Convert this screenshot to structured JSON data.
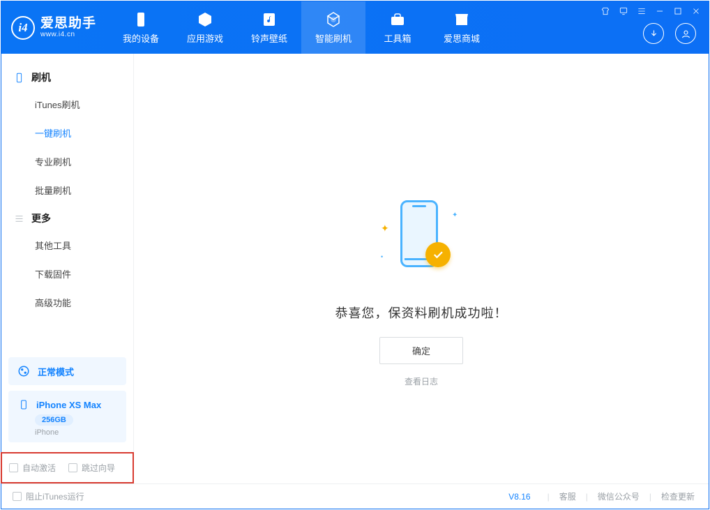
{
  "app": {
    "title": "爱思助手",
    "subtitle": "www.i4.cn"
  },
  "nav": {
    "items": [
      {
        "label": "我的设备",
        "icon": "device"
      },
      {
        "label": "应用游戏",
        "icon": "cube"
      },
      {
        "label": "铃声壁纸",
        "icon": "music"
      },
      {
        "label": "智能刷机",
        "icon": "refresh",
        "active": true
      },
      {
        "label": "工具箱",
        "icon": "toolbox"
      },
      {
        "label": "爱思商城",
        "icon": "store"
      }
    ]
  },
  "sidebar": {
    "section1_title": "刷机",
    "section1_items": [
      {
        "label": "iTunes刷机"
      },
      {
        "label": "一键刷机",
        "active": true
      },
      {
        "label": "专业刷机"
      },
      {
        "label": "批量刷机"
      }
    ],
    "section2_title": "更多",
    "section2_items": [
      {
        "label": "其他工具"
      },
      {
        "label": "下载固件"
      },
      {
        "label": "高级功能"
      }
    ],
    "mode_label": "正常模式",
    "device_name": "iPhone XS Max",
    "device_capacity": "256GB",
    "device_type": "iPhone",
    "checkbox1": "自动激活",
    "checkbox2": "跳过向导"
  },
  "main": {
    "success_msg": "恭喜您，保资料刷机成功啦！",
    "ok_label": "确定",
    "log_label": "查看日志"
  },
  "footer": {
    "stop_itunes": "阻止iTunes运行",
    "version": "V8.16",
    "links": [
      "客服",
      "微信公众号",
      "检查更新"
    ]
  }
}
